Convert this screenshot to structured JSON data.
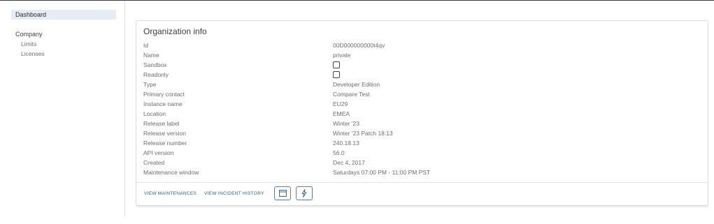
{
  "sidebar": {
    "dashboard": "Dashboard",
    "company": "Company",
    "limits": "Limits",
    "licenses": "Licenses"
  },
  "card": {
    "title": "Organization info",
    "rows": [
      {
        "label": "Id",
        "value": "00D000000000t4qv"
      },
      {
        "label": "Name",
        "value": "private"
      },
      {
        "label": "Sandbox",
        "value": ""
      },
      {
        "label": "Readonly",
        "value": ""
      },
      {
        "label": "Type",
        "value": "Developer Edition"
      },
      {
        "label": "Primary contact",
        "value": "Compare Test"
      },
      {
        "label": "Instance name",
        "value": "EU29"
      },
      {
        "label": "Location",
        "value": "EMEA"
      },
      {
        "label": "Release label",
        "value": "Winter '23"
      },
      {
        "label": "Release version",
        "value": "Winter '23 Patch 18.13"
      },
      {
        "label": "Release number",
        "value": "240.18.13"
      },
      {
        "label": "API version",
        "value": "56.0"
      },
      {
        "label": "Created",
        "value": "Dec 4, 2017"
      },
      {
        "label": "Maintenance window",
        "value": "Saturdays 07:00 PM - 11:00 PM PST"
      }
    ],
    "sandbox_checked": false,
    "readonly_checked": false,
    "footer": {
      "view_maintenances": "VIEW MAINTENANCES",
      "view_incident_history": "VIEW INCIDENT HISTORY",
      "calendar_icon": "calendar-icon",
      "bolt_icon": "lightning-bolt-icon"
    }
  },
  "colors": {
    "accent": "#2f5c8a",
    "sidebar_active_bg": "#e5ecf3"
  }
}
